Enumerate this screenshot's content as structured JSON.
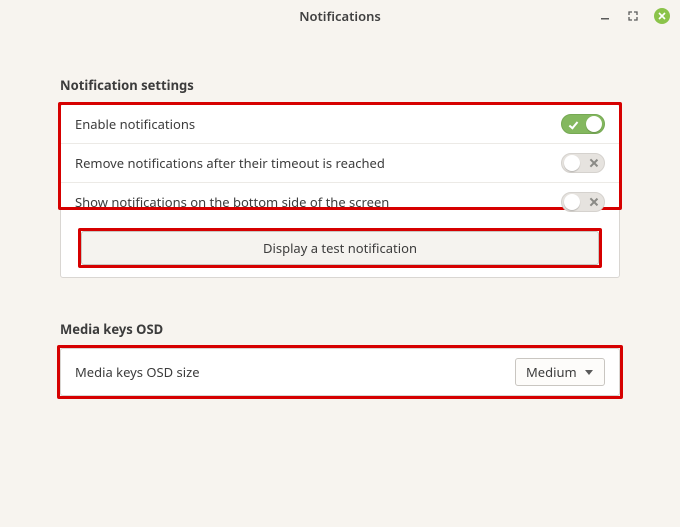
{
  "window": {
    "title": "Notifications"
  },
  "sections": {
    "notification_settings": {
      "label": "Notification settings",
      "rows": {
        "enable": {
          "label": "Enable notifications",
          "on": true
        },
        "remove_timeout": {
          "label": "Remove notifications after their timeout is reached",
          "on": false
        },
        "bottom": {
          "label": "Show notifications on the bottom side of the screen",
          "on": false
        }
      },
      "test_button": "Display a test notification"
    },
    "media_osd": {
      "label": "Media keys OSD",
      "rows": {
        "size": {
          "label": "Media keys OSD size",
          "value": "Medium"
        }
      }
    }
  }
}
